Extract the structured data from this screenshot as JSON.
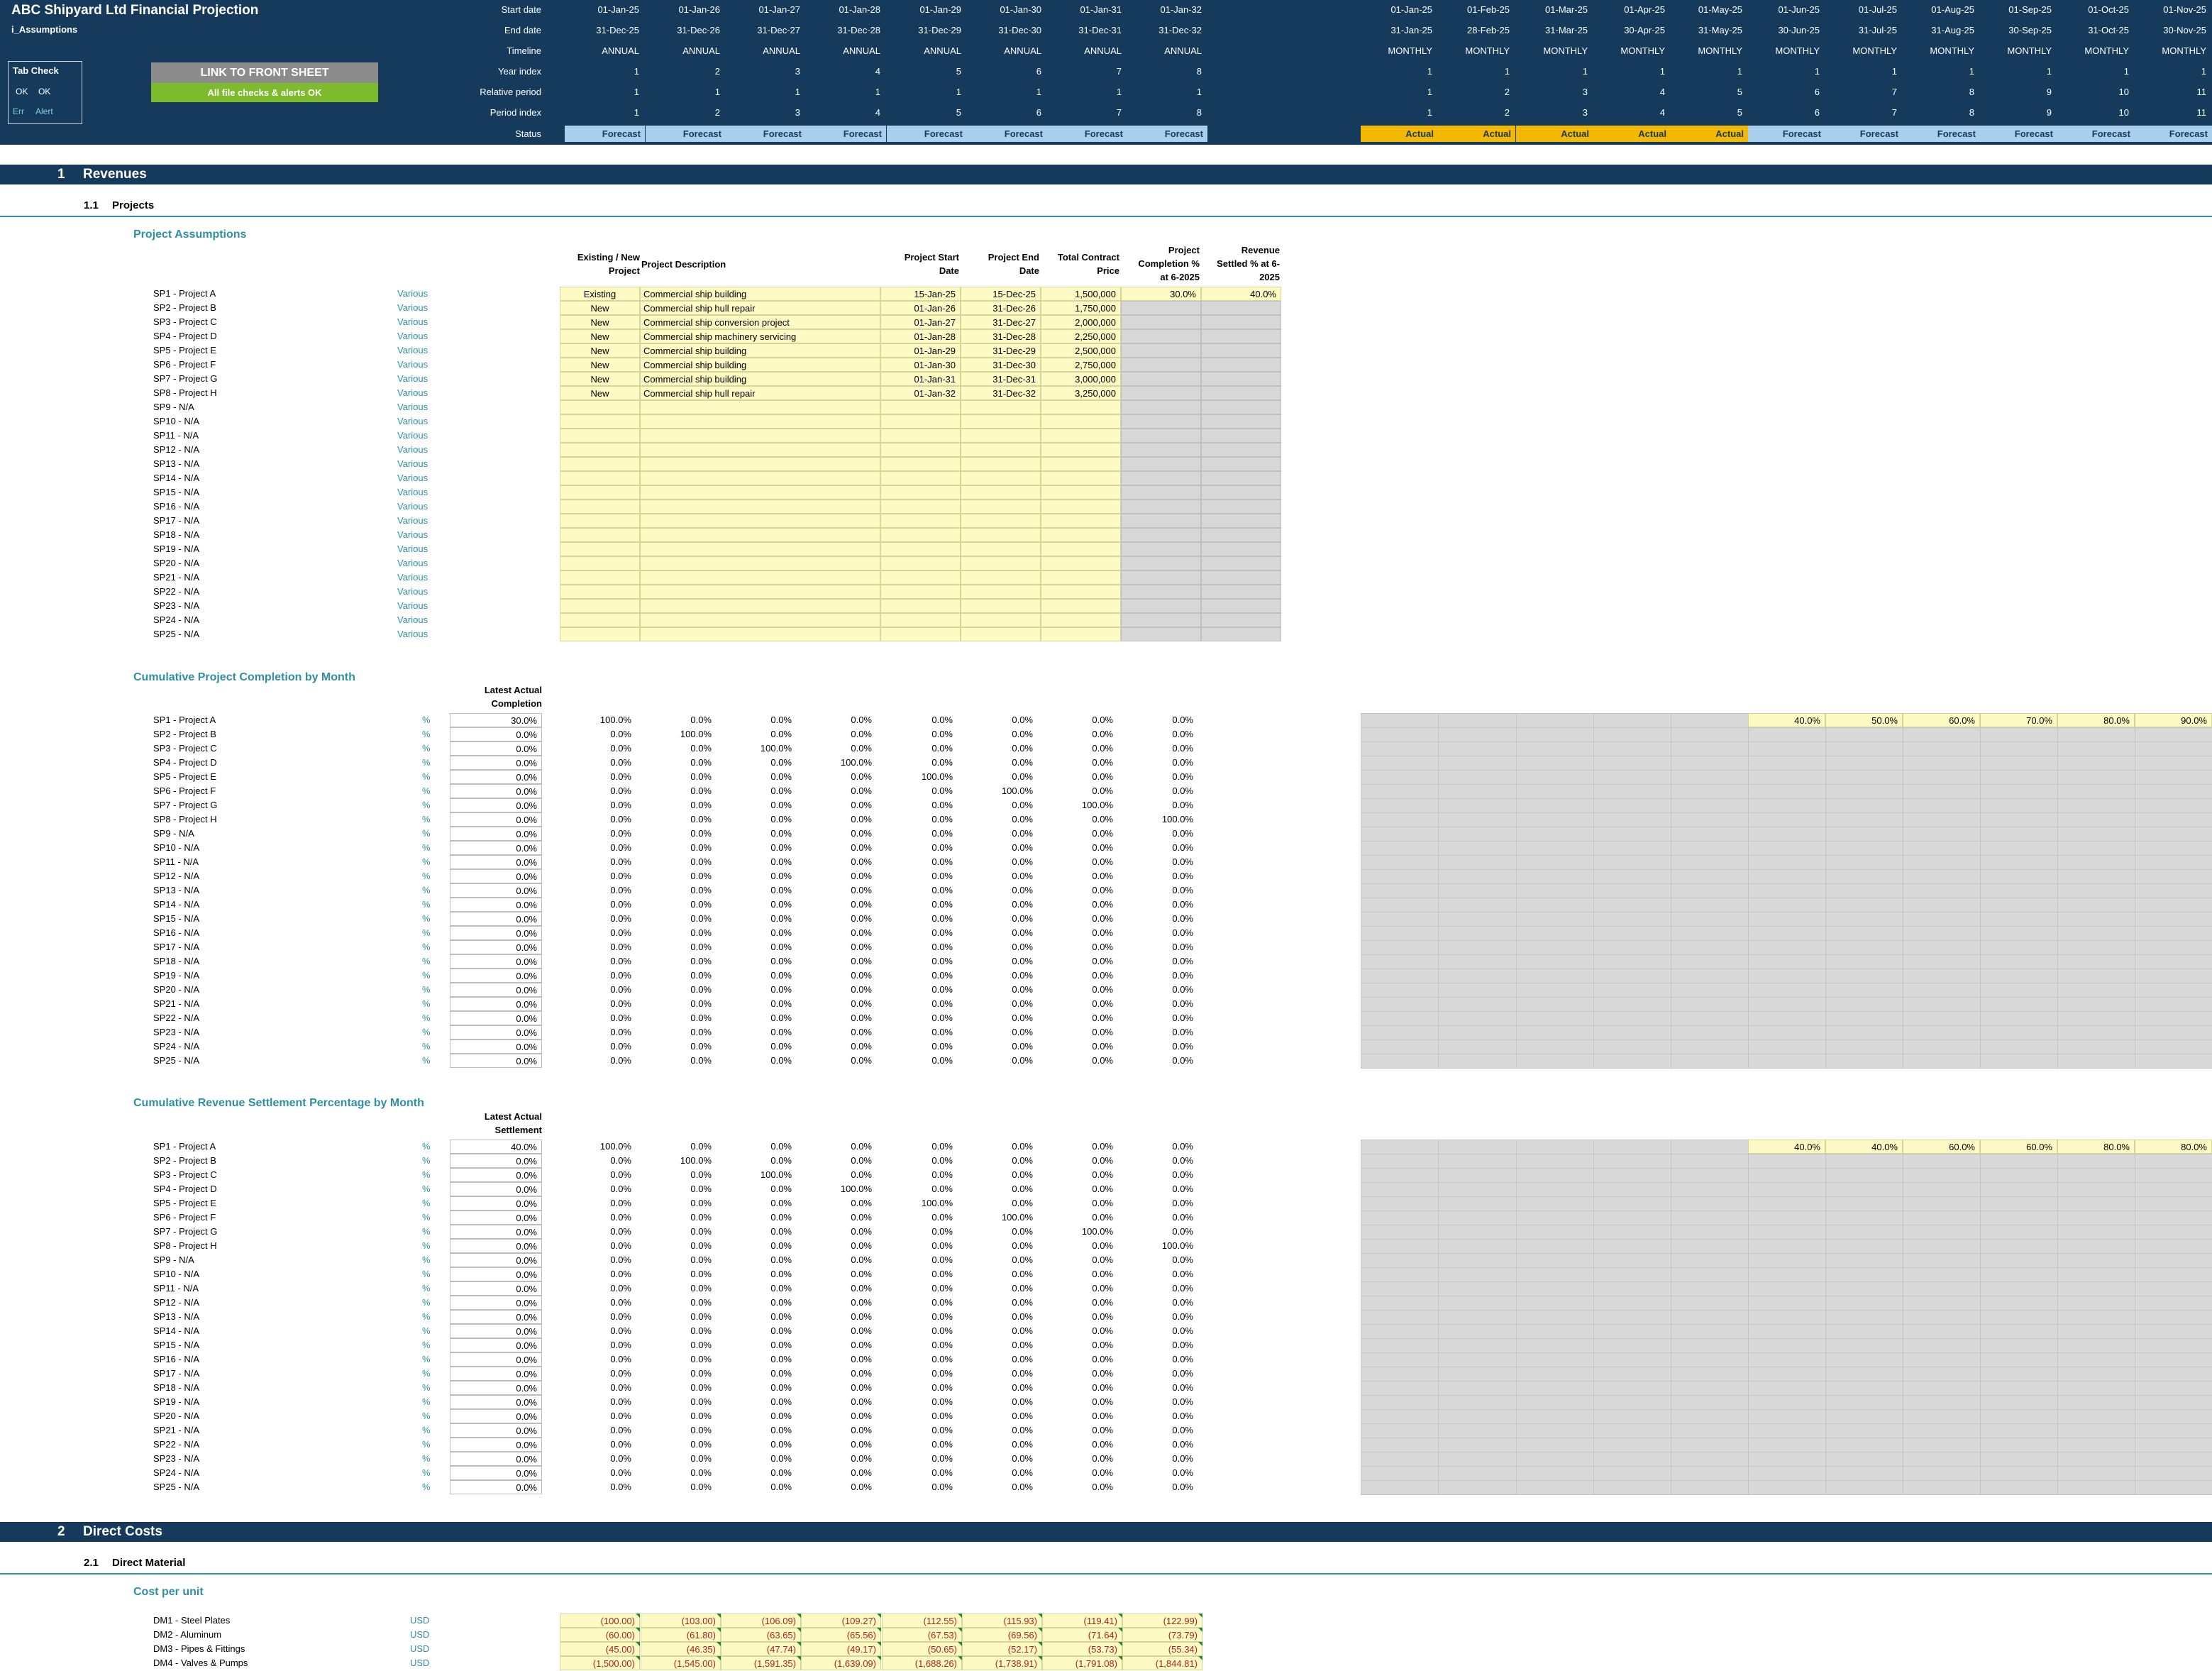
{
  "header": {
    "title": "ABC Shipyard Ltd Financial Projection",
    "sheet": "i_Assumptions",
    "tab_check": {
      "title": "Tab Check",
      "ok1": "OK",
      "ok2": "OK",
      "err": "Err",
      "alert": "Alert"
    },
    "link_button": "LINK TO FRONT SHEET",
    "status_button": "All file checks & alerts OK",
    "row_labels": [
      "Start date",
      "End date",
      "Timeline",
      "Year index",
      "Relative period",
      "Period index",
      "Status"
    ],
    "annual": {
      "start": [
        "01-Jan-25",
        "01-Jan-26",
        "01-Jan-27",
        "01-Jan-28",
        "01-Jan-29",
        "01-Jan-30",
        "01-Jan-31",
        "01-Jan-32"
      ],
      "end": [
        "31-Dec-25",
        "31-Dec-26",
        "31-Dec-27",
        "31-Dec-28",
        "31-Dec-29",
        "31-Dec-30",
        "31-Dec-31",
        "31-Dec-32"
      ],
      "timeline": "ANNUAL",
      "year_index": [
        "1",
        "2",
        "3",
        "4",
        "5",
        "6",
        "7",
        "8"
      ],
      "relative": [
        "1",
        "1",
        "1",
        "1",
        "1",
        "1",
        "1",
        "1"
      ],
      "period_index": [
        "1",
        "2",
        "3",
        "4",
        "5",
        "6",
        "7",
        "8"
      ],
      "status": [
        "Forecast",
        "Forecast",
        "Forecast",
        "Forecast",
        "Forecast",
        "Forecast",
        "Forecast",
        "Forecast"
      ]
    },
    "monthly": {
      "start": [
        "01-Jan-25",
        "01-Feb-25",
        "01-Mar-25",
        "01-Apr-25",
        "01-May-25",
        "01-Jun-25",
        "01-Jul-25",
        "01-Aug-25",
        "01-Sep-25",
        "01-Oct-25",
        "01-Nov-25"
      ],
      "end": [
        "31-Jan-25",
        "28-Feb-25",
        "31-Mar-25",
        "30-Apr-25",
        "31-May-25",
        "30-Jun-25",
        "31-Jul-25",
        "31-Aug-25",
        "30-Sep-25",
        "31-Oct-25",
        "30-Nov-25"
      ],
      "timeline": "MONTHLY",
      "year_index": [
        "1",
        "1",
        "1",
        "1",
        "1",
        "1",
        "1",
        "1",
        "1",
        "1",
        "1"
      ],
      "relative": [
        "1",
        "2",
        "3",
        "4",
        "5",
        "6",
        "7",
        "8",
        "9",
        "10",
        "11"
      ],
      "period_index": [
        "1",
        "2",
        "3",
        "4",
        "5",
        "6",
        "7",
        "8",
        "9",
        "10",
        "11"
      ],
      "status": [
        "Actual",
        "Actual",
        "Actual",
        "Actual",
        "Actual",
        "Forecast",
        "Forecast",
        "Forecast",
        "Forecast",
        "Forecast",
        "Forecast"
      ]
    }
  },
  "sections": {
    "s1_num": "1",
    "s1_title": "Revenues",
    "s11_num": "1.1",
    "s11_title": "Projects",
    "s2_num": "2",
    "s2_title": "Direct Costs",
    "s21_num": "2.1",
    "s21_title": "Direct Material"
  },
  "project_assumptions": {
    "title": "Project Assumptions",
    "headers": {
      "existing_new": [
        "Existing / New",
        "Project"
      ],
      "description": [
        "Project Description"
      ],
      "start": [
        "Project Start",
        "Date"
      ],
      "end": [
        "Project End",
        "Date"
      ],
      "price": [
        "Total Contract",
        "Price"
      ],
      "completion": [
        "Project",
        "Completion %",
        "at 6-2025"
      ],
      "settled": [
        "Revenue",
        "Settled % at 6-",
        "2025"
      ]
    },
    "unit": "Various",
    "rows": [
      {
        "label": "SP1 - Project A",
        "type": "Existing",
        "desc": "Commercial ship building",
        "start": "15-Jan-25",
        "end": "15-Dec-25",
        "price": "1,500,000",
        "completion": "30.0%",
        "settled": "40.0%"
      },
      {
        "label": "SP2 - Project B",
        "type": "New",
        "desc": "Commercial ship hull repair",
        "start": "01-Jan-26",
        "end": "31-Dec-26",
        "price": "1,750,000"
      },
      {
        "label": "SP3 - Project C",
        "type": "New",
        "desc": "Commercial ship conversion project",
        "start": "01-Jan-27",
        "end": "31-Dec-27",
        "price": "2,000,000"
      },
      {
        "label": "SP4 - Project D",
        "type": "New",
        "desc": "Commercial ship machinery servicing",
        "start": "01-Jan-28",
        "end": "31-Dec-28",
        "price": "2,250,000"
      },
      {
        "label": "SP5 - Project E",
        "type": "New",
        "desc": "Commercial ship building",
        "start": "01-Jan-29",
        "end": "31-Dec-29",
        "price": "2,500,000"
      },
      {
        "label": "SP6 - Project F",
        "type": "New",
        "desc": "Commercial ship building",
        "start": "01-Jan-30",
        "end": "31-Dec-30",
        "price": "2,750,000"
      },
      {
        "label": "SP7 - Project G",
        "type": "New",
        "desc": "Commercial ship building",
        "start": "01-Jan-31",
        "end": "31-Dec-31",
        "price": "3,000,000"
      },
      {
        "label": "SP8 - Project H",
        "type": "New",
        "desc": "Commercial ship hull repair",
        "start": "01-Jan-32",
        "end": "31-Dec-32",
        "price": "3,250,000"
      },
      {
        "label": "SP9 - N/A"
      },
      {
        "label": "SP10 - N/A"
      },
      {
        "label": "SP11 - N/A"
      },
      {
        "label": "SP12 - N/A"
      },
      {
        "label": "SP13 - N/A"
      },
      {
        "label": "SP14 - N/A"
      },
      {
        "label": "SP15 - N/A"
      },
      {
        "label": "SP16 - N/A"
      },
      {
        "label": "SP17 - N/A"
      },
      {
        "label": "SP18 - N/A"
      },
      {
        "label": "SP19 - N/A"
      },
      {
        "label": "SP20 - N/A"
      },
      {
        "label": "SP21 - N/A"
      },
      {
        "label": "SP22 - N/A"
      },
      {
        "label": "SP23 - N/A"
      },
      {
        "label": "SP24 - N/A"
      },
      {
        "label": "SP25 - N/A"
      }
    ]
  },
  "completion": {
    "title": "Cumulative Project Completion by Month",
    "latest_header": [
      "Latest Actual",
      "Completion"
    ],
    "unit": "%",
    "latest": [
      "30.0%",
      "0.0%",
      "0.0%",
      "0.0%",
      "0.0%",
      "0.0%",
      "0.0%",
      "0.0%",
      "0.0%",
      "0.0%",
      "0.0%",
      "0.0%",
      "0.0%",
      "0.0%",
      "0.0%",
      "0.0%",
      "0.0%",
      "0.0%",
      "0.0%",
      "0.0%",
      "0.0%",
      "0.0%",
      "0.0%",
      "0.0%",
      "0.0%"
    ],
    "monthly_row1": [
      "40.0%",
      "50.0%",
      "60.0%",
      "70.0%",
      "80.0%",
      "90.0%"
    ]
  },
  "settlement": {
    "title": "Cumulative Revenue Settlement Percentage by Month",
    "latest_header": [
      "Latest Actual",
      "Settlement"
    ],
    "unit": "%",
    "latest": [
      "40.0%",
      "0.0%",
      "0.0%",
      "0.0%",
      "0.0%",
      "0.0%",
      "0.0%",
      "0.0%",
      "0.0%",
      "0.0%",
      "0.0%",
      "0.0%",
      "0.0%",
      "0.0%",
      "0.0%",
      "0.0%",
      "0.0%",
      "0.0%",
      "0.0%",
      "0.0%",
      "0.0%",
      "0.0%",
      "0.0%",
      "0.0%",
      "0.0%"
    ],
    "monthly_row1": [
      "40.0%",
      "40.0%",
      "60.0%",
      "60.0%",
      "80.0%",
      "80.0%"
    ]
  },
  "annual_pct": {
    "full": "100.0%",
    "zero": "0.0%"
  },
  "direct_material": {
    "title": "Cost per unit",
    "unit": "USD",
    "rows": [
      {
        "label": "DM1 - Steel Plates",
        "values": [
          "(100.00)",
          "(103.00)",
          "(106.09)",
          "(109.27)",
          "(112.55)",
          "(115.93)",
          "(119.41)",
          "(122.99)"
        ]
      },
      {
        "label": "DM2 - Aluminum",
        "values": [
          "(60.00)",
          "(61.80)",
          "(63.65)",
          "(65.56)",
          "(67.53)",
          "(69.56)",
          "(71.64)",
          "(73.79)"
        ]
      },
      {
        "label": "DM3 - Pipes & Fittings",
        "values": [
          "(45.00)",
          "(46.35)",
          "(47.74)",
          "(49.17)",
          "(50.65)",
          "(52.17)",
          "(53.73)",
          "(55.34)"
        ]
      },
      {
        "label": "DM4 - Valves & Pumps",
        "values": [
          "(1,500.00)",
          "(1,545.00)",
          "(1,591.35)",
          "(1,639.09)",
          "(1,688.26)",
          "(1,738.91)",
          "(1,791.08)",
          "(1,844.81)"
        ]
      }
    ]
  },
  "colors": {
    "header_bg": "#163a5c",
    "forecast": "#a9cfed",
    "actual": "#f5b800",
    "input": "#fdfbc3",
    "teal": "#2f8fa3",
    "link_btn": "#8c8c8c",
    "ok_btn": "#7dbb2c"
  }
}
